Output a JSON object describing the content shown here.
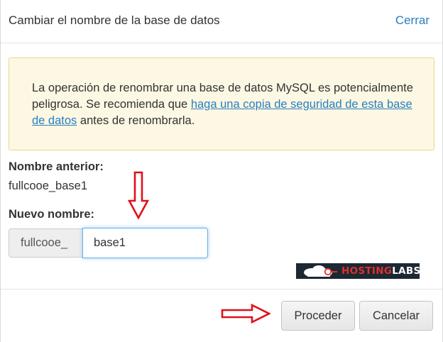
{
  "header": {
    "title": "Cambiar el nombre de la base de datos",
    "close_label": "Cerrar"
  },
  "warning": {
    "text_before": "La operación de renombrar una base de datos MySQL es potencialmente peligrosa. Se recomienda que ",
    "link_text": "haga una copia de seguridad de esta base de datos",
    "text_after": " antes de renombrarla."
  },
  "old_name": {
    "label": "Nombre anterior:",
    "value": "fullcooe_base1"
  },
  "new_name": {
    "label": "Nuevo nombre:",
    "prefix": "fullcooe_",
    "input_value": "base1"
  },
  "logo": {
    "text_part1": "HOSTING",
    "text_part2": "LABS"
  },
  "footer": {
    "proceed_label": "Proceder",
    "cancel_label": "Cancelar"
  },
  "colors": {
    "link": "#2b7ec1",
    "warning_bg": "#fcf8e3",
    "warning_border": "#ecd58a",
    "annotation_arrow": "#e0101b",
    "input_focus": "#66afe9"
  },
  "icons": {
    "annotation_down": "arrow-down-icon",
    "annotation_right": "arrow-right-icon",
    "logo_mark": "cloud-logo-icon"
  }
}
